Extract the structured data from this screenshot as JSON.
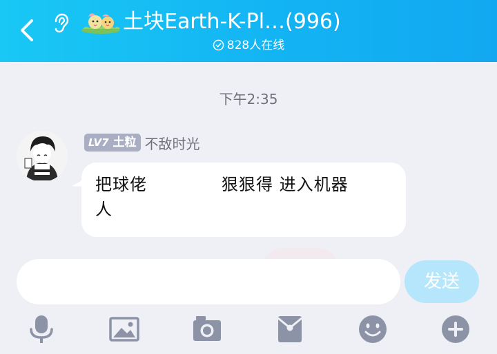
{
  "header": {
    "title": "土块Earth-K-Pl…(996)",
    "online": "828人在线"
  },
  "chat": {
    "timestamp": "下午2:35",
    "message": {
      "level_badge": "LV7",
      "title_badge": "土粒",
      "sender_name": "不敌时光",
      "text_part1": "把球佬",
      "text_part2": "狠狠得 进入机器",
      "text_part3": "人"
    }
  },
  "input": {
    "value": "",
    "placeholder": ""
  },
  "send_button": {
    "label": "发送"
  },
  "toolbar": {
    "icons": [
      "microphone-icon",
      "image-icon",
      "camera-icon",
      "red-packet-icon",
      "emoji-icon",
      "plus-icon"
    ]
  },
  "colors": {
    "header_start": "#19c8f5",
    "header_end": "#12a8f1",
    "background": "#eef0f6",
    "badge": "#a9aec3",
    "send_disabled": "#b6e6fb",
    "icon_gray": "#8d93a6"
  }
}
